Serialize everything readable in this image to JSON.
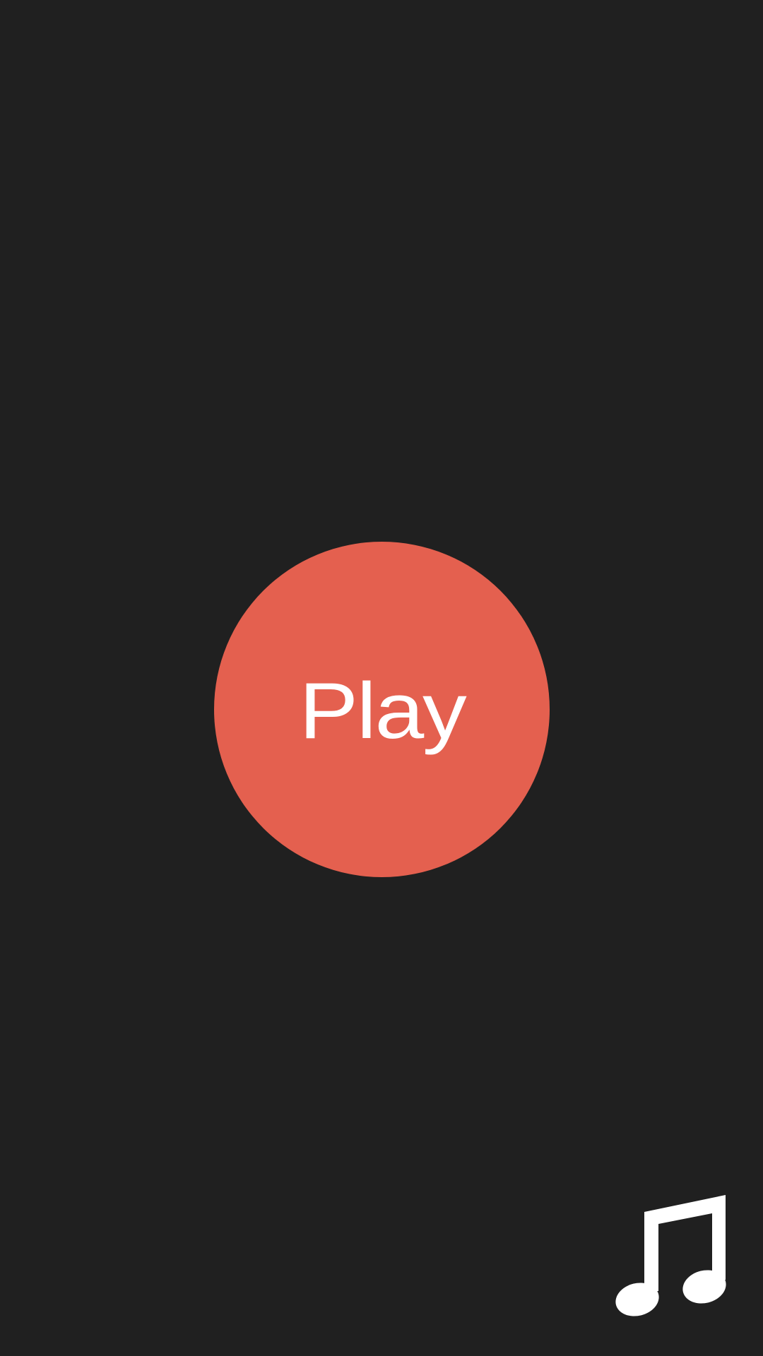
{
  "screen": {
    "background_color": "#202020"
  },
  "play_button": {
    "label": "Play",
    "color": "#e4604f",
    "text_color": "#ffffff"
  },
  "music_toggle": {
    "icon": "music-note-icon",
    "color": "#ffffff"
  }
}
